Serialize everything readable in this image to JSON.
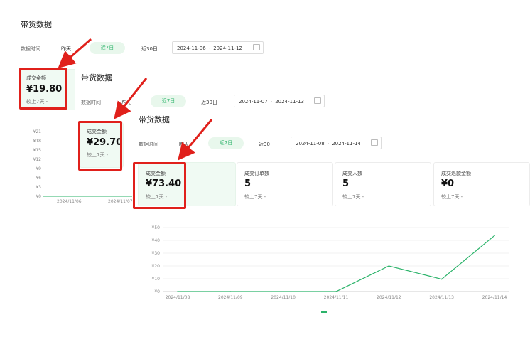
{
  "panel1": {
    "title": "带货数据",
    "time_label": "数据时间",
    "tab_yesterday": "昨天",
    "tab_7days": "近7日",
    "tab_30days": "近30日",
    "date_start": "2024-11-06",
    "date_end": "2024-11-12",
    "card_label": "成交金额",
    "card_value": "¥19.80",
    "card_compare": "较上7天 -",
    "y_ticks": [
      "¥21",
      "¥18",
      "¥15",
      "¥12",
      "¥9",
      "¥6",
      "¥3",
      "¥0"
    ],
    "x_ticks": [
      "2024/11/06",
      "2024/11/07"
    ]
  },
  "panel2": {
    "title": "带货数据",
    "time_label": "数据时间",
    "tab_yesterday": "昨天",
    "tab_7days": "近7日",
    "tab_30days": "近30日",
    "date_start": "2024-11-07",
    "date_end": "2024-11-13",
    "card_label": "成交金额",
    "card_value": "¥29.70",
    "card_compare": "较上7天 -"
  },
  "panel3": {
    "title": "带货数据",
    "time_label": "数据时间",
    "tab_yesterday": "昨天",
    "tab_7days": "近7日",
    "tab_30days": "近30日",
    "date_start": "2024-11-08",
    "date_end": "2024-11-14",
    "cards": [
      {
        "label": "成交金额",
        "value": "¥73.40",
        "compare": "较上7天 -"
      },
      {
        "label": "成交订单数",
        "value": "5",
        "compare": "较上7天 -"
      },
      {
        "label": "成交人数",
        "value": "5",
        "compare": "较上7天 -"
      },
      {
        "label": "成交退款金额",
        "value": "¥0",
        "compare": "较上7天 -"
      }
    ]
  },
  "colors": {
    "accent": "#2bb36a",
    "annotation": "#e0201b"
  },
  "chart_data": {
    "type": "line",
    "x": [
      "2024/11/08",
      "2024/11/09",
      "2024/11/10",
      "2024/11/11",
      "2024/11/12",
      "2024/11/13",
      "2024/11/14"
    ],
    "y_ticks": [
      "¥50",
      "¥40",
      "¥30",
      "¥20",
      "¥10",
      "¥0"
    ],
    "ylim": [
      0,
      50
    ],
    "series": [
      {
        "values": [
          0,
          0,
          0,
          0,
          20,
          9.7,
          43.7
        ]
      }
    ],
    "grid": true
  }
}
